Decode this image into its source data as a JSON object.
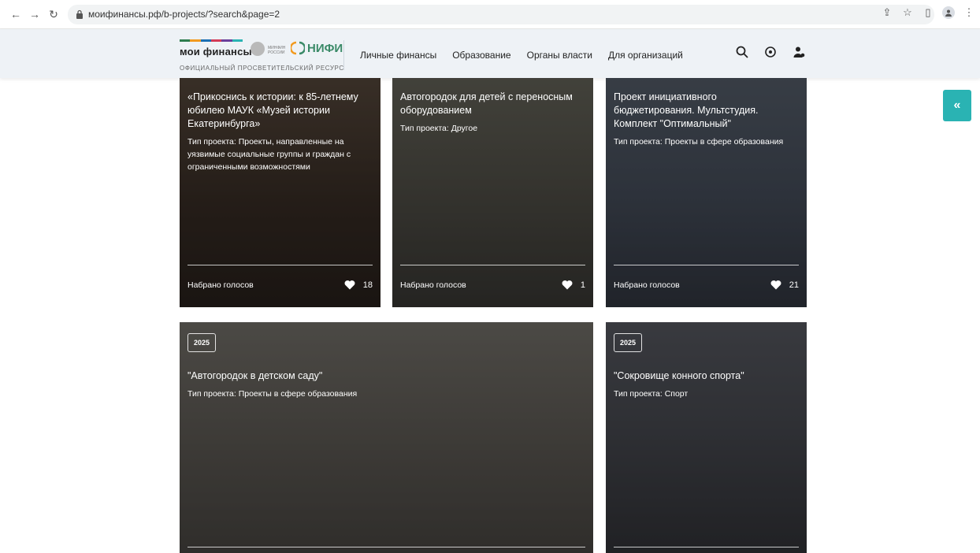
{
  "browser": {
    "url": "моифинансы.рф/b-projects/?search&page=2"
  },
  "header": {
    "brand": "мои финансы",
    "minfin_text": "МИНФИН РОССИИ",
    "nifi": "НИФИ",
    "tagline": "ОФИЦИАЛЬНЫЙ ПРОСВЕТИТЕЛЬСКИЙ РЕСУРС",
    "nav": [
      "Личные финансы",
      "Образование",
      "Органы власти",
      "Для организаций"
    ],
    "stripe_colors": [
      "#2e7d4f",
      "#f29a1f",
      "#1a6fb3",
      "#d33b57",
      "#6a3f9b",
      "#2ab3b3"
    ]
  },
  "side_button": {
    "label": "«"
  },
  "cards": [
    {
      "title": "«Прикоснись к истории: к 85-летнему юбилею МАУК «Музей истории Екатеринбурга»",
      "type": "Тип проекта: Проекты, направленные на уязвимые социальные группы и граждан с ограниченными возможностями",
      "votes_label": "Набрано голосов",
      "votes": "18",
      "photo_color": "#4a3d34"
    },
    {
      "title": "Автогородок для детей с переносным оборудованием",
      "type": "Тип проекта: Другое",
      "votes_label": "Набрано голосов",
      "votes": "1",
      "photo_color": "#5d5a52"
    },
    {
      "title": "Проект инициативного бюджетирования. Мультстудия. Комплект \"Оптимальный\"",
      "type": "Тип проекта: Проекты в сфере образования",
      "votes_label": "Набрано голосов",
      "votes": "21",
      "photo_color": "#4f5866"
    },
    {
      "year": "2025",
      "title": "\"Автогородок в детском саду\"",
      "type": "Тип проекта: Проекты в сфере образования",
      "photo_color": "#6a6660"
    },
    {
      "year": "2025",
      "title": "\"Сокровище конного спорта\"",
      "type": "Тип проекта: Спорт",
      "photo_color": "#4d4f57"
    }
  ]
}
